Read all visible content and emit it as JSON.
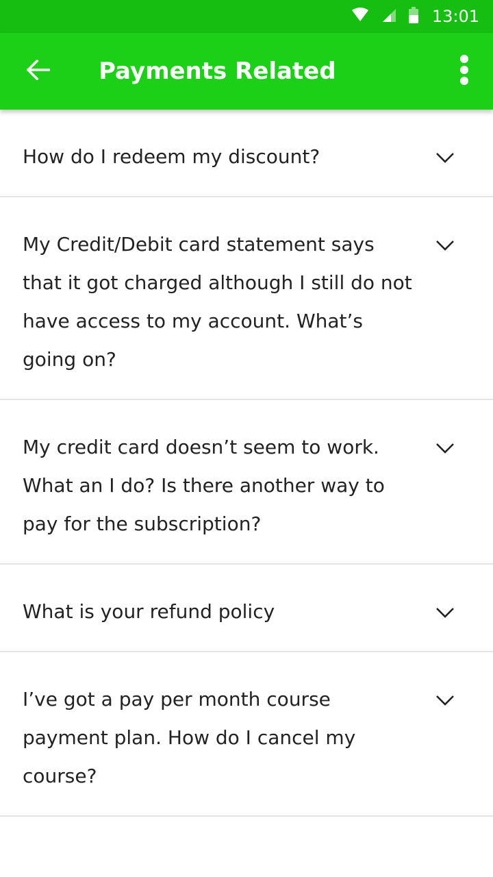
{
  "status_bar": {
    "time": "13:01",
    "icons": [
      "wifi-icon",
      "cell-signal-icon",
      "battery-icon"
    ],
    "background": "#16be12"
  },
  "app_bar": {
    "title": "Payments Related",
    "back_icon": "arrow-left-icon",
    "overflow_icon": "more-vertical-icon",
    "background": "#1ccf17"
  },
  "faq": {
    "chevron_icon": "chevron-down-icon",
    "items": [
      {
        "question": "How do I redeem my discount?"
      },
      {
        "question": "My Credit/Debit card statement says that it got charged although I still do not have access to my account. What’s going on?"
      },
      {
        "question": "My credit card doesn’t seem to work. What an I do? Is there another way to pay for the subscription?"
      },
      {
        "question": "What is your refund policy"
      },
      {
        "question": "I’ve got a pay per month course payment plan. How do I cancel my course?"
      }
    ]
  }
}
